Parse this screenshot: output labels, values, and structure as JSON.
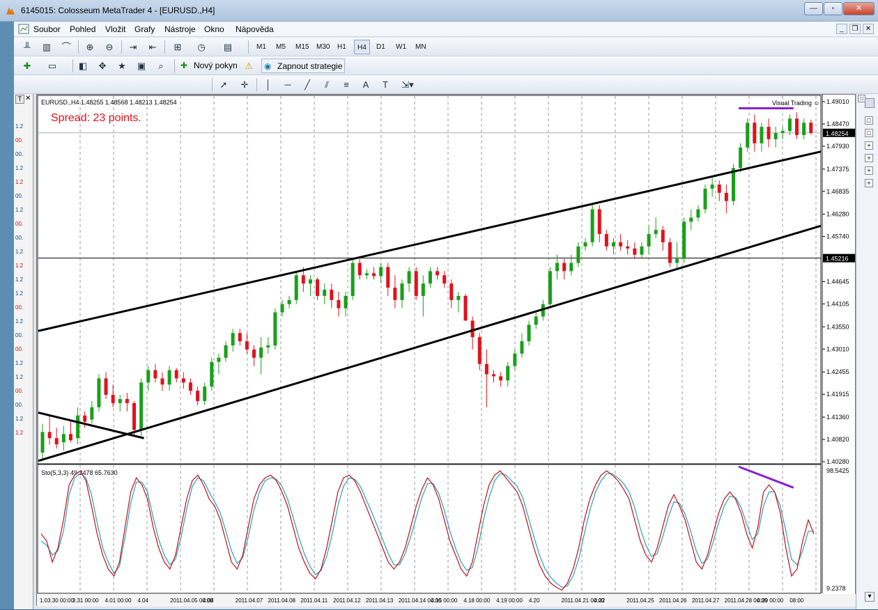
{
  "window": {
    "title": "6145015: Colosseum MetaTrader 4 - [EURUSD.,H4]",
    "buttons": [
      "—",
      "▫",
      "✕"
    ]
  },
  "menu": [
    "Soubor",
    "Pohled",
    "Vložit",
    "Grafy",
    "Nástroje",
    "Okno",
    "Nápověda"
  ],
  "timeframes": [
    "M1",
    "M5",
    "M15",
    "M30",
    "H1",
    "H4",
    "D1",
    "W1",
    "MN"
  ],
  "selected_tf": "H4",
  "toolbar2": {
    "new_order": "Nový pokyn",
    "strategy": "Zapnout strategie"
  },
  "left_panel": {
    "header": "T",
    "rows": [
      "1.2",
      "00.",
      "00.",
      "1.2",
      "1.2",
      "00.",
      "1.2",
      "00.",
      "00.",
      "1.2",
      "1.2",
      "1.2",
      "1.2",
      "00.",
      "1.2",
      "00.",
      "00.",
      "1.2",
      "1.2",
      "00.",
      "00.",
      "1.2",
      "1.2"
    ]
  },
  "colors": {
    "bull": "#18a018",
    "bear": "#e0121e",
    "k": "#c0101a",
    "d": "#2aa0b8",
    "purple": "#8a1fd1",
    "spread": "#e0101c"
  },
  "chart_data": {
    "type": "candlestick",
    "symbol_header": "EURUSD.,H4  1.48255  1.48568  1.48213  1.48254",
    "spread_label": "Spread: 23 points.",
    "watermark": "Visual Trading ☺",
    "ylim": [
      1.4028,
      1.4901
    ],
    "y_ticks": [
      "1.49010",
      "1.48470",
      "1.47930",
      "1.47375",
      "1.46835",
      "1.46280",
      "1.45740",
      "1.44645",
      "1.44105",
      "1.43550",
      "1.43010",
      "1.42455",
      "1.41915",
      "1.41360",
      "1.40820",
      "1.40280"
    ],
    "y_tick_values": [
      1.4901,
      1.4847,
      1.4793,
      1.47375,
      1.46835,
      1.4628,
      1.4574,
      1.44645,
      1.44105,
      1.4355,
      1.4301,
      1.42455,
      1.41915,
      1.4136,
      1.4082,
      1.4028
    ],
    "current_price_label": "1.48254",
    "current_price": 1.48254,
    "hline_label": "1.45216",
    "hline": 1.45216,
    "x_labels": [
      "1.03.30 00:00",
      "3.31 00:00",
      "4.01 00:00",
      "4.04",
      "2011.04.05 00:00",
      "4.08",
      "2011.04.07",
      "2011.04.08",
      "2011.04.11",
      "2011.04.12",
      "2011.04.13",
      "2011.04.14 00:00",
      "4.15 00:00",
      "4.18 00:00",
      "4.19 00:00",
      "4.20",
      "2011.04.21 00:00",
      "4.22",
      "2011.04.25",
      "2011.04.26",
      "2011.04.27",
      "2011.04.28 00:00",
      "4.29 00:00",
      "08:00"
    ],
    "ohlc": [
      [
        1.405,
        1.412,
        1.4035,
        1.41
      ],
      [
        1.41,
        1.414,
        1.407,
        1.4085
      ],
      [
        1.4085,
        1.411,
        1.406,
        1.407
      ],
      [
        1.4075,
        1.4115,
        1.4055,
        1.4095
      ],
      [
        1.4095,
        1.413,
        1.4075,
        1.408
      ],
      [
        1.4085,
        1.416,
        1.407,
        1.414
      ],
      [
        1.414,
        1.415,
        1.411,
        1.4125
      ],
      [
        1.413,
        1.4175,
        1.412,
        1.416
      ],
      [
        1.416,
        1.424,
        1.415,
        1.423
      ],
      [
        1.423,
        1.4245,
        1.418,
        1.419
      ],
      [
        1.419,
        1.4215,
        1.416,
        1.417
      ],
      [
        1.417,
        1.419,
        1.415,
        1.418
      ],
      [
        1.418,
        1.4195,
        1.415,
        1.417
      ],
      [
        1.417,
        1.4175,
        1.409,
        1.4105
      ],
      [
        1.4105,
        1.423,
        1.409,
        1.422
      ],
      [
        1.422,
        1.426,
        1.42,
        1.425
      ],
      [
        1.425,
        1.4265,
        1.422,
        1.423
      ],
      [
        1.423,
        1.4245,
        1.42,
        1.4215
      ],
      [
        1.4215,
        1.426,
        1.42,
        1.425
      ],
      [
        1.425,
        1.4255,
        1.422,
        1.423
      ],
      [
        1.423,
        1.4245,
        1.4205,
        1.422
      ],
      [
        1.422,
        1.423,
        1.419,
        1.42
      ],
      [
        1.42,
        1.421,
        1.4165,
        1.4175
      ],
      [
        1.4175,
        1.422,
        1.4165,
        1.421
      ],
      [
        1.421,
        1.428,
        1.42,
        1.427
      ],
      [
        1.427,
        1.429,
        1.424,
        1.428
      ],
      [
        1.428,
        1.432,
        1.427,
        1.431
      ],
      [
        1.431,
        1.435,
        1.4295,
        1.434
      ],
      [
        1.434,
        1.435,
        1.431,
        1.432
      ],
      [
        1.432,
        1.434,
        1.429,
        1.43
      ],
      [
        1.43,
        1.431,
        1.426,
        1.428
      ],
      [
        1.428,
        1.433,
        1.424,
        1.4305
      ],
      [
        1.4305,
        1.433,
        1.429,
        1.431
      ],
      [
        1.431,
        1.44,
        1.43,
        1.439
      ],
      [
        1.439,
        1.442,
        1.438,
        1.441
      ],
      [
        1.441,
        1.443,
        1.44,
        1.442
      ],
      [
        1.442,
        1.449,
        1.441,
        1.448
      ],
      [
        1.448,
        1.45,
        1.444,
        1.446
      ],
      [
        1.446,
        1.448,
        1.443,
        1.447
      ],
      [
        1.447,
        1.4475,
        1.442,
        1.443
      ],
      [
        1.443,
        1.446,
        1.441,
        1.4445
      ],
      [
        1.4445,
        1.446,
        1.44,
        1.442
      ],
      [
        1.442,
        1.444,
        1.438,
        1.44
      ],
      [
        1.44,
        1.444,
        1.438,
        1.443
      ],
      [
        1.443,
        1.452,
        1.442,
        1.451
      ],
      [
        1.451,
        1.452,
        1.447,
        1.448
      ],
      [
        1.448,
        1.4495,
        1.447,
        1.4485
      ],
      [
        1.4485,
        1.45,
        1.447,
        1.4478
      ],
      [
        1.4478,
        1.451,
        1.446,
        1.45
      ],
      [
        1.45,
        1.451,
        1.443,
        1.445
      ],
      [
        1.445,
        1.448,
        1.44,
        1.442
      ],
      [
        1.442,
        1.447,
        1.44,
        1.446
      ],
      [
        1.446,
        1.45,
        1.444,
        1.449
      ],
      [
        1.449,
        1.45,
        1.442,
        1.443
      ],
      [
        1.443,
        1.448,
        1.438,
        1.446
      ],
      [
        1.446,
        1.45,
        1.445,
        1.449
      ],
      [
        1.449,
        1.45,
        1.447,
        1.448
      ],
      [
        1.448,
        1.449,
        1.445,
        1.446
      ],
      [
        1.446,
        1.447,
        1.44,
        1.442
      ],
      [
        1.442,
        1.444,
        1.439,
        1.443
      ],
      [
        1.443,
        1.4435,
        1.438,
        1.437
      ],
      [
        1.437,
        1.438,
        1.43,
        1.433
      ],
      [
        1.433,
        1.434,
        1.425,
        1.4265
      ],
      [
        1.4265,
        1.43,
        1.416,
        1.424
      ],
      [
        1.424,
        1.425,
        1.422,
        1.4235
      ],
      [
        1.4235,
        1.4245,
        1.421,
        1.4225
      ],
      [
        1.4225,
        1.427,
        1.421,
        1.426
      ],
      [
        1.426,
        1.43,
        1.425,
        1.429
      ],
      [
        1.429,
        1.434,
        1.428,
        1.432
      ],
      [
        1.432,
        1.437,
        1.431,
        1.436
      ],
      [
        1.436,
        1.439,
        1.435,
        1.438
      ],
      [
        1.438,
        1.442,
        1.437,
        1.441
      ],
      [
        1.441,
        1.45,
        1.44,
        1.449
      ],
      [
        1.449,
        1.453,
        1.447,
        1.451
      ],
      [
        1.451,
        1.452,
        1.447,
        1.449
      ],
      [
        1.449,
        1.453,
        1.448,
        1.451
      ],
      [
        1.451,
        1.456,
        1.45,
        1.455
      ],
      [
        1.455,
        1.457,
        1.454,
        1.456
      ],
      [
        1.456,
        1.465,
        1.455,
        1.464
      ],
      [
        1.464,
        1.465,
        1.456,
        1.458
      ],
      [
        1.458,
        1.459,
        1.454,
        1.455
      ],
      [
        1.455,
        1.457,
        1.453,
        1.456
      ],
      [
        1.456,
        1.458,
        1.454,
        1.455
      ],
      [
        1.455,
        1.4565,
        1.453,
        1.4545
      ],
      [
        1.4545,
        1.456,
        1.452,
        1.453
      ],
      [
        1.453,
        1.456,
        1.452,
        1.455
      ],
      [
        1.455,
        1.46,
        1.453,
        1.458
      ],
      [
        1.458,
        1.462,
        1.457,
        1.459
      ],
      [
        1.459,
        1.46,
        1.454,
        1.456
      ],
      [
        1.456,
        1.457,
        1.45,
        1.451
      ],
      [
        1.451,
        1.456,
        1.4495,
        1.452
      ],
      [
        1.452,
        1.462,
        1.451,
        1.461
      ],
      [
        1.461,
        1.464,
        1.459,
        1.462
      ],
      [
        1.462,
        1.465,
        1.461,
        1.464
      ],
      [
        1.464,
        1.47,
        1.463,
        1.469
      ],
      [
        1.469,
        1.472,
        1.467,
        1.47
      ],
      [
        1.47,
        1.471,
        1.466,
        1.468
      ],
      [
        1.468,
        1.47,
        1.463,
        1.466
      ],
      [
        1.466,
        1.475,
        1.465,
        1.474
      ],
      [
        1.474,
        1.48,
        1.473,
        1.479
      ],
      [
        1.479,
        1.486,
        1.478,
        1.485
      ],
      [
        1.485,
        1.487,
        1.478,
        1.48
      ],
      [
        1.48,
        1.485,
        1.478,
        1.484
      ],
      [
        1.484,
        1.486,
        1.479,
        1.481
      ],
      [
        1.481,
        1.484,
        1.479,
        1.4825
      ],
      [
        1.4825,
        1.484,
        1.481,
        1.483
      ],
      [
        1.483,
        1.487,
        1.482,
        1.486
      ],
      [
        1.486,
        1.4875,
        1.481,
        1.482
      ],
      [
        1.482,
        1.486,
        1.481,
        1.485
      ],
      [
        1.485,
        1.4857,
        1.4821,
        1.4825
      ]
    ],
    "trendlines": [
      {
        "x0": 0,
        "y0": 1.4345,
        "x1": 1,
        "y1": 1.478
      },
      {
        "x0": 0,
        "y0": 1.403,
        "x1": 1,
        "y1": 1.46
      },
      {
        "x0": 0,
        "y0": 1.4147,
        "x1": 0.135,
        "y1": 1.4085
      }
    ],
    "purple_line": {
      "x0": 0.895,
      "x1": 0.965,
      "y": 1.4885
    },
    "stoch": {
      "label": "Sto(5,3,3) 49.2478 65.7630",
      "max_label": "98.5425",
      "min_label": "9.2378",
      "ylim": [
        9.2378,
        98.5425
      ],
      "k": [
        50,
        45,
        30,
        40,
        60,
        85,
        92,
        95,
        88,
        70,
        50,
        35,
        25,
        20,
        30,
        55,
        80,
        90,
        85,
        75,
        55,
        40,
        30,
        25,
        35,
        55,
        75,
        88,
        92,
        85,
        75,
        70,
        60,
        45,
        30,
        25,
        35,
        55,
        75,
        85,
        90,
        92,
        88,
        80,
        70,
        55,
        40,
        30,
        22,
        18,
        25,
        40,
        60,
        80,
        90,
        92,
        88,
        80,
        70,
        60,
        50,
        40,
        30,
        25,
        30,
        40,
        55,
        70,
        82,
        90,
        85,
        75,
        60,
        45,
        35,
        25,
        20,
        30,
        50,
        70,
        85,
        92,
        95,
        90,
        85,
        80,
        70,
        55,
        40,
        28,
        20,
        15,
        12,
        10,
        15,
        25,
        40,
        60,
        75,
        85,
        92,
        95,
        92,
        88,
        82,
        75,
        60,
        45,
        35,
        30,
        40,
        55,
        70,
        78,
        70,
        60,
        45,
        30,
        25,
        35,
        50,
        65,
        75,
        80,
        75,
        65,
        50,
        40,
        55,
        80,
        85,
        80,
        65,
        40,
        20,
        25,
        45,
        60,
        50
      ],
      "d": [
        45,
        42,
        35,
        38,
        52,
        78,
        90,
        93,
        90,
        78,
        58,
        40,
        30,
        22,
        27,
        48,
        72,
        87,
        87,
        80,
        62,
        46,
        35,
        28,
        32,
        48,
        68,
        84,
        90,
        88,
        80,
        73,
        65,
        52,
        38,
        29,
        33,
        48,
        67,
        80,
        88,
        90,
        89,
        84,
        75,
        62,
        48,
        36,
        27,
        21,
        24,
        34,
        50,
        70,
        84,
        90,
        89,
        84,
        75,
        66,
        56,
        46,
        36,
        28,
        28,
        36,
        48,
        62,
        76,
        86,
        86,
        79,
        67,
        52,
        40,
        30,
        24,
        26,
        40,
        60,
        76,
        88,
        93,
        92,
        88,
        84,
        76,
        62,
        48,
        35,
        25,
        19,
        15,
        12,
        13,
        20,
        32,
        50,
        67,
        80,
        88,
        93,
        93,
        90,
        86,
        80,
        69,
        54,
        42,
        34,
        36,
        48,
        62,
        73,
        72,
        64,
        52,
        38,
        29,
        32,
        44,
        58,
        70,
        77,
        76,
        69,
        57,
        46,
        50,
        70,
        80,
        80,
        70,
        52,
        32,
        28,
        38,
        52,
        52
      ],
      "purple_line": {
        "x0": 0.895,
        "x1": 0.965,
        "y0": 98.0,
        "y1": 83.0
      }
    }
  }
}
